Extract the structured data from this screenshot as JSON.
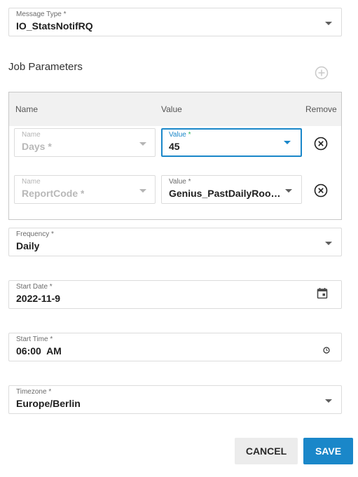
{
  "message_type": {
    "label": "Message Type *",
    "value": "IO_StatsNotifRQ"
  },
  "job_parameters": {
    "title": "Job Parameters",
    "add_icon": "plus-circle-icon",
    "columns": {
      "name": "Name",
      "value": "Value",
      "remove": "Remove"
    },
    "rows": [
      {
        "name_label": "Name",
        "name_value": "Days *",
        "value_label": "Value *",
        "value_value": "45",
        "remove_icon": "close-circle-icon"
      },
      {
        "name_label": "Name",
        "name_value": "ReportCode *",
        "value_label": "Value *",
        "value_value": "Genius_PastDailyRoom...",
        "remove_icon": "close-circle-icon"
      }
    ]
  },
  "frequency": {
    "label": "Frequency *",
    "value": "Daily"
  },
  "start_date": {
    "label": "Start Date *",
    "value": "2022-11-9",
    "icon": "calendar-icon"
  },
  "start_time": {
    "label": "Start Time *",
    "value": "06:00  AM",
    "icon": "clock-icon"
  },
  "timezone": {
    "label": "Timezone *",
    "value": "Europe/Berlin"
  },
  "actions": {
    "cancel": "CANCEL",
    "save": "SAVE"
  },
  "colors": {
    "accent": "#1a87c9",
    "required_star_focused": "#2db35a",
    "border": "#dcdcdc",
    "header_bg": "#f1f1f1"
  }
}
